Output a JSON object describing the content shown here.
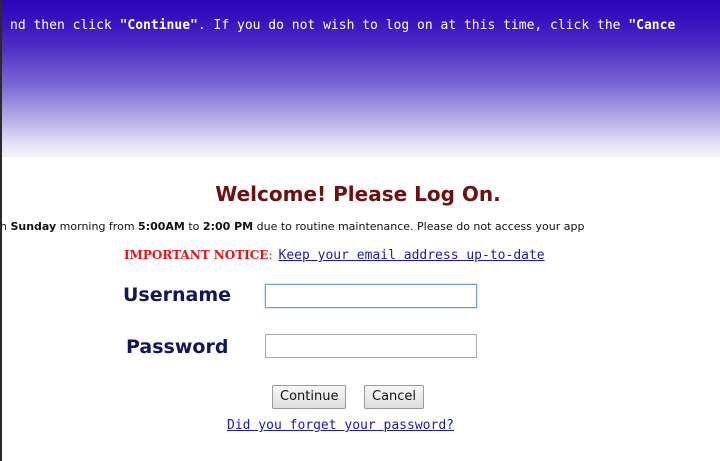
{
  "banner": {
    "pre": "nd then click ",
    "continue_q": "\"Continue\"",
    "mid": ". If you do not wish to log on at this time, click the ",
    "cancel_q": "\"Cance"
  },
  "title": "Welcome! Please Log On.",
  "maintenance": {
    "pre": "h ",
    "day": "Sunday",
    "t1": " morning from ",
    "start": "5:00AM",
    "t2": " to ",
    "end": "2:00 PM",
    "t3": " due to routine maintenance. Please do not access your app"
  },
  "notice": {
    "label": "IMPORTANT NOTICE",
    "colon": ":",
    "link": "Keep your email address up-to-date"
  },
  "form": {
    "username_label": "Username",
    "username_value": "",
    "password_label": "Password",
    "password_value": ""
  },
  "buttons": {
    "continue": "Continue",
    "cancel": "Cancel"
  },
  "forgot_link": "Did you forget your password?",
  "colors": {
    "banner_top": "#2a06b8",
    "title": "#6f0f12",
    "label": "#10175e",
    "notice": "#ee1111",
    "link": "#1a1ab8"
  }
}
